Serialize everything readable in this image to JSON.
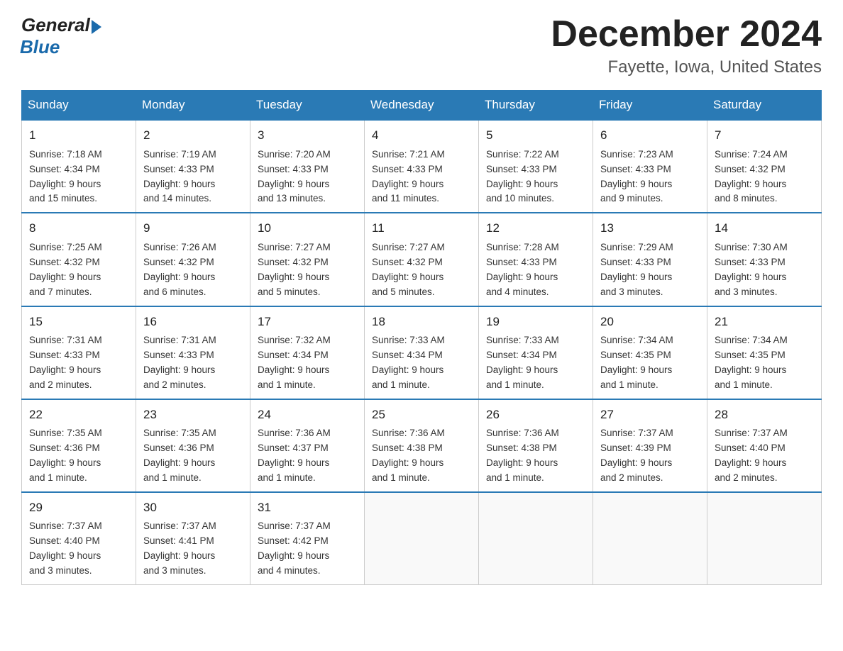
{
  "header": {
    "logo_general": "General",
    "logo_blue": "Blue",
    "month_title": "December 2024",
    "location": "Fayette, Iowa, United States"
  },
  "days_of_week": [
    "Sunday",
    "Monday",
    "Tuesday",
    "Wednesday",
    "Thursday",
    "Friday",
    "Saturday"
  ],
  "weeks": [
    [
      {
        "num": "1",
        "sunrise": "7:18 AM",
        "sunset": "4:34 PM",
        "daylight": "9 hours and 15 minutes."
      },
      {
        "num": "2",
        "sunrise": "7:19 AM",
        "sunset": "4:33 PM",
        "daylight": "9 hours and 14 minutes."
      },
      {
        "num": "3",
        "sunrise": "7:20 AM",
        "sunset": "4:33 PM",
        "daylight": "9 hours and 13 minutes."
      },
      {
        "num": "4",
        "sunrise": "7:21 AM",
        "sunset": "4:33 PM",
        "daylight": "9 hours and 11 minutes."
      },
      {
        "num": "5",
        "sunrise": "7:22 AM",
        "sunset": "4:33 PM",
        "daylight": "9 hours and 10 minutes."
      },
      {
        "num": "6",
        "sunrise": "7:23 AM",
        "sunset": "4:33 PM",
        "daylight": "9 hours and 9 minutes."
      },
      {
        "num": "7",
        "sunrise": "7:24 AM",
        "sunset": "4:32 PM",
        "daylight": "9 hours and 8 minutes."
      }
    ],
    [
      {
        "num": "8",
        "sunrise": "7:25 AM",
        "sunset": "4:32 PM",
        "daylight": "9 hours and 7 minutes."
      },
      {
        "num": "9",
        "sunrise": "7:26 AM",
        "sunset": "4:32 PM",
        "daylight": "9 hours and 6 minutes."
      },
      {
        "num": "10",
        "sunrise": "7:27 AM",
        "sunset": "4:32 PM",
        "daylight": "9 hours and 5 minutes."
      },
      {
        "num": "11",
        "sunrise": "7:27 AM",
        "sunset": "4:32 PM",
        "daylight": "9 hours and 5 minutes."
      },
      {
        "num": "12",
        "sunrise": "7:28 AM",
        "sunset": "4:33 PM",
        "daylight": "9 hours and 4 minutes."
      },
      {
        "num": "13",
        "sunrise": "7:29 AM",
        "sunset": "4:33 PM",
        "daylight": "9 hours and 3 minutes."
      },
      {
        "num": "14",
        "sunrise": "7:30 AM",
        "sunset": "4:33 PM",
        "daylight": "9 hours and 3 minutes."
      }
    ],
    [
      {
        "num": "15",
        "sunrise": "7:31 AM",
        "sunset": "4:33 PM",
        "daylight": "9 hours and 2 minutes."
      },
      {
        "num": "16",
        "sunrise": "7:31 AM",
        "sunset": "4:33 PM",
        "daylight": "9 hours and 2 minutes."
      },
      {
        "num": "17",
        "sunrise": "7:32 AM",
        "sunset": "4:34 PM",
        "daylight": "9 hours and 1 minute."
      },
      {
        "num": "18",
        "sunrise": "7:33 AM",
        "sunset": "4:34 PM",
        "daylight": "9 hours and 1 minute."
      },
      {
        "num": "19",
        "sunrise": "7:33 AM",
        "sunset": "4:34 PM",
        "daylight": "9 hours and 1 minute."
      },
      {
        "num": "20",
        "sunrise": "7:34 AM",
        "sunset": "4:35 PM",
        "daylight": "9 hours and 1 minute."
      },
      {
        "num": "21",
        "sunrise": "7:34 AM",
        "sunset": "4:35 PM",
        "daylight": "9 hours and 1 minute."
      }
    ],
    [
      {
        "num": "22",
        "sunrise": "7:35 AM",
        "sunset": "4:36 PM",
        "daylight": "9 hours and 1 minute."
      },
      {
        "num": "23",
        "sunrise": "7:35 AM",
        "sunset": "4:36 PM",
        "daylight": "9 hours and 1 minute."
      },
      {
        "num": "24",
        "sunrise": "7:36 AM",
        "sunset": "4:37 PM",
        "daylight": "9 hours and 1 minute."
      },
      {
        "num": "25",
        "sunrise": "7:36 AM",
        "sunset": "4:38 PM",
        "daylight": "9 hours and 1 minute."
      },
      {
        "num": "26",
        "sunrise": "7:36 AM",
        "sunset": "4:38 PM",
        "daylight": "9 hours and 1 minute."
      },
      {
        "num": "27",
        "sunrise": "7:37 AM",
        "sunset": "4:39 PM",
        "daylight": "9 hours and 2 minutes."
      },
      {
        "num": "28",
        "sunrise": "7:37 AM",
        "sunset": "4:40 PM",
        "daylight": "9 hours and 2 minutes."
      }
    ],
    [
      {
        "num": "29",
        "sunrise": "7:37 AM",
        "sunset": "4:40 PM",
        "daylight": "9 hours and 3 minutes."
      },
      {
        "num": "30",
        "sunrise": "7:37 AM",
        "sunset": "4:41 PM",
        "daylight": "9 hours and 3 minutes."
      },
      {
        "num": "31",
        "sunrise": "7:37 AM",
        "sunset": "4:42 PM",
        "daylight": "9 hours and 4 minutes."
      },
      null,
      null,
      null,
      null
    ]
  ],
  "labels": {
    "sunrise": "Sunrise:",
    "sunset": "Sunset:",
    "daylight": "Daylight:"
  }
}
